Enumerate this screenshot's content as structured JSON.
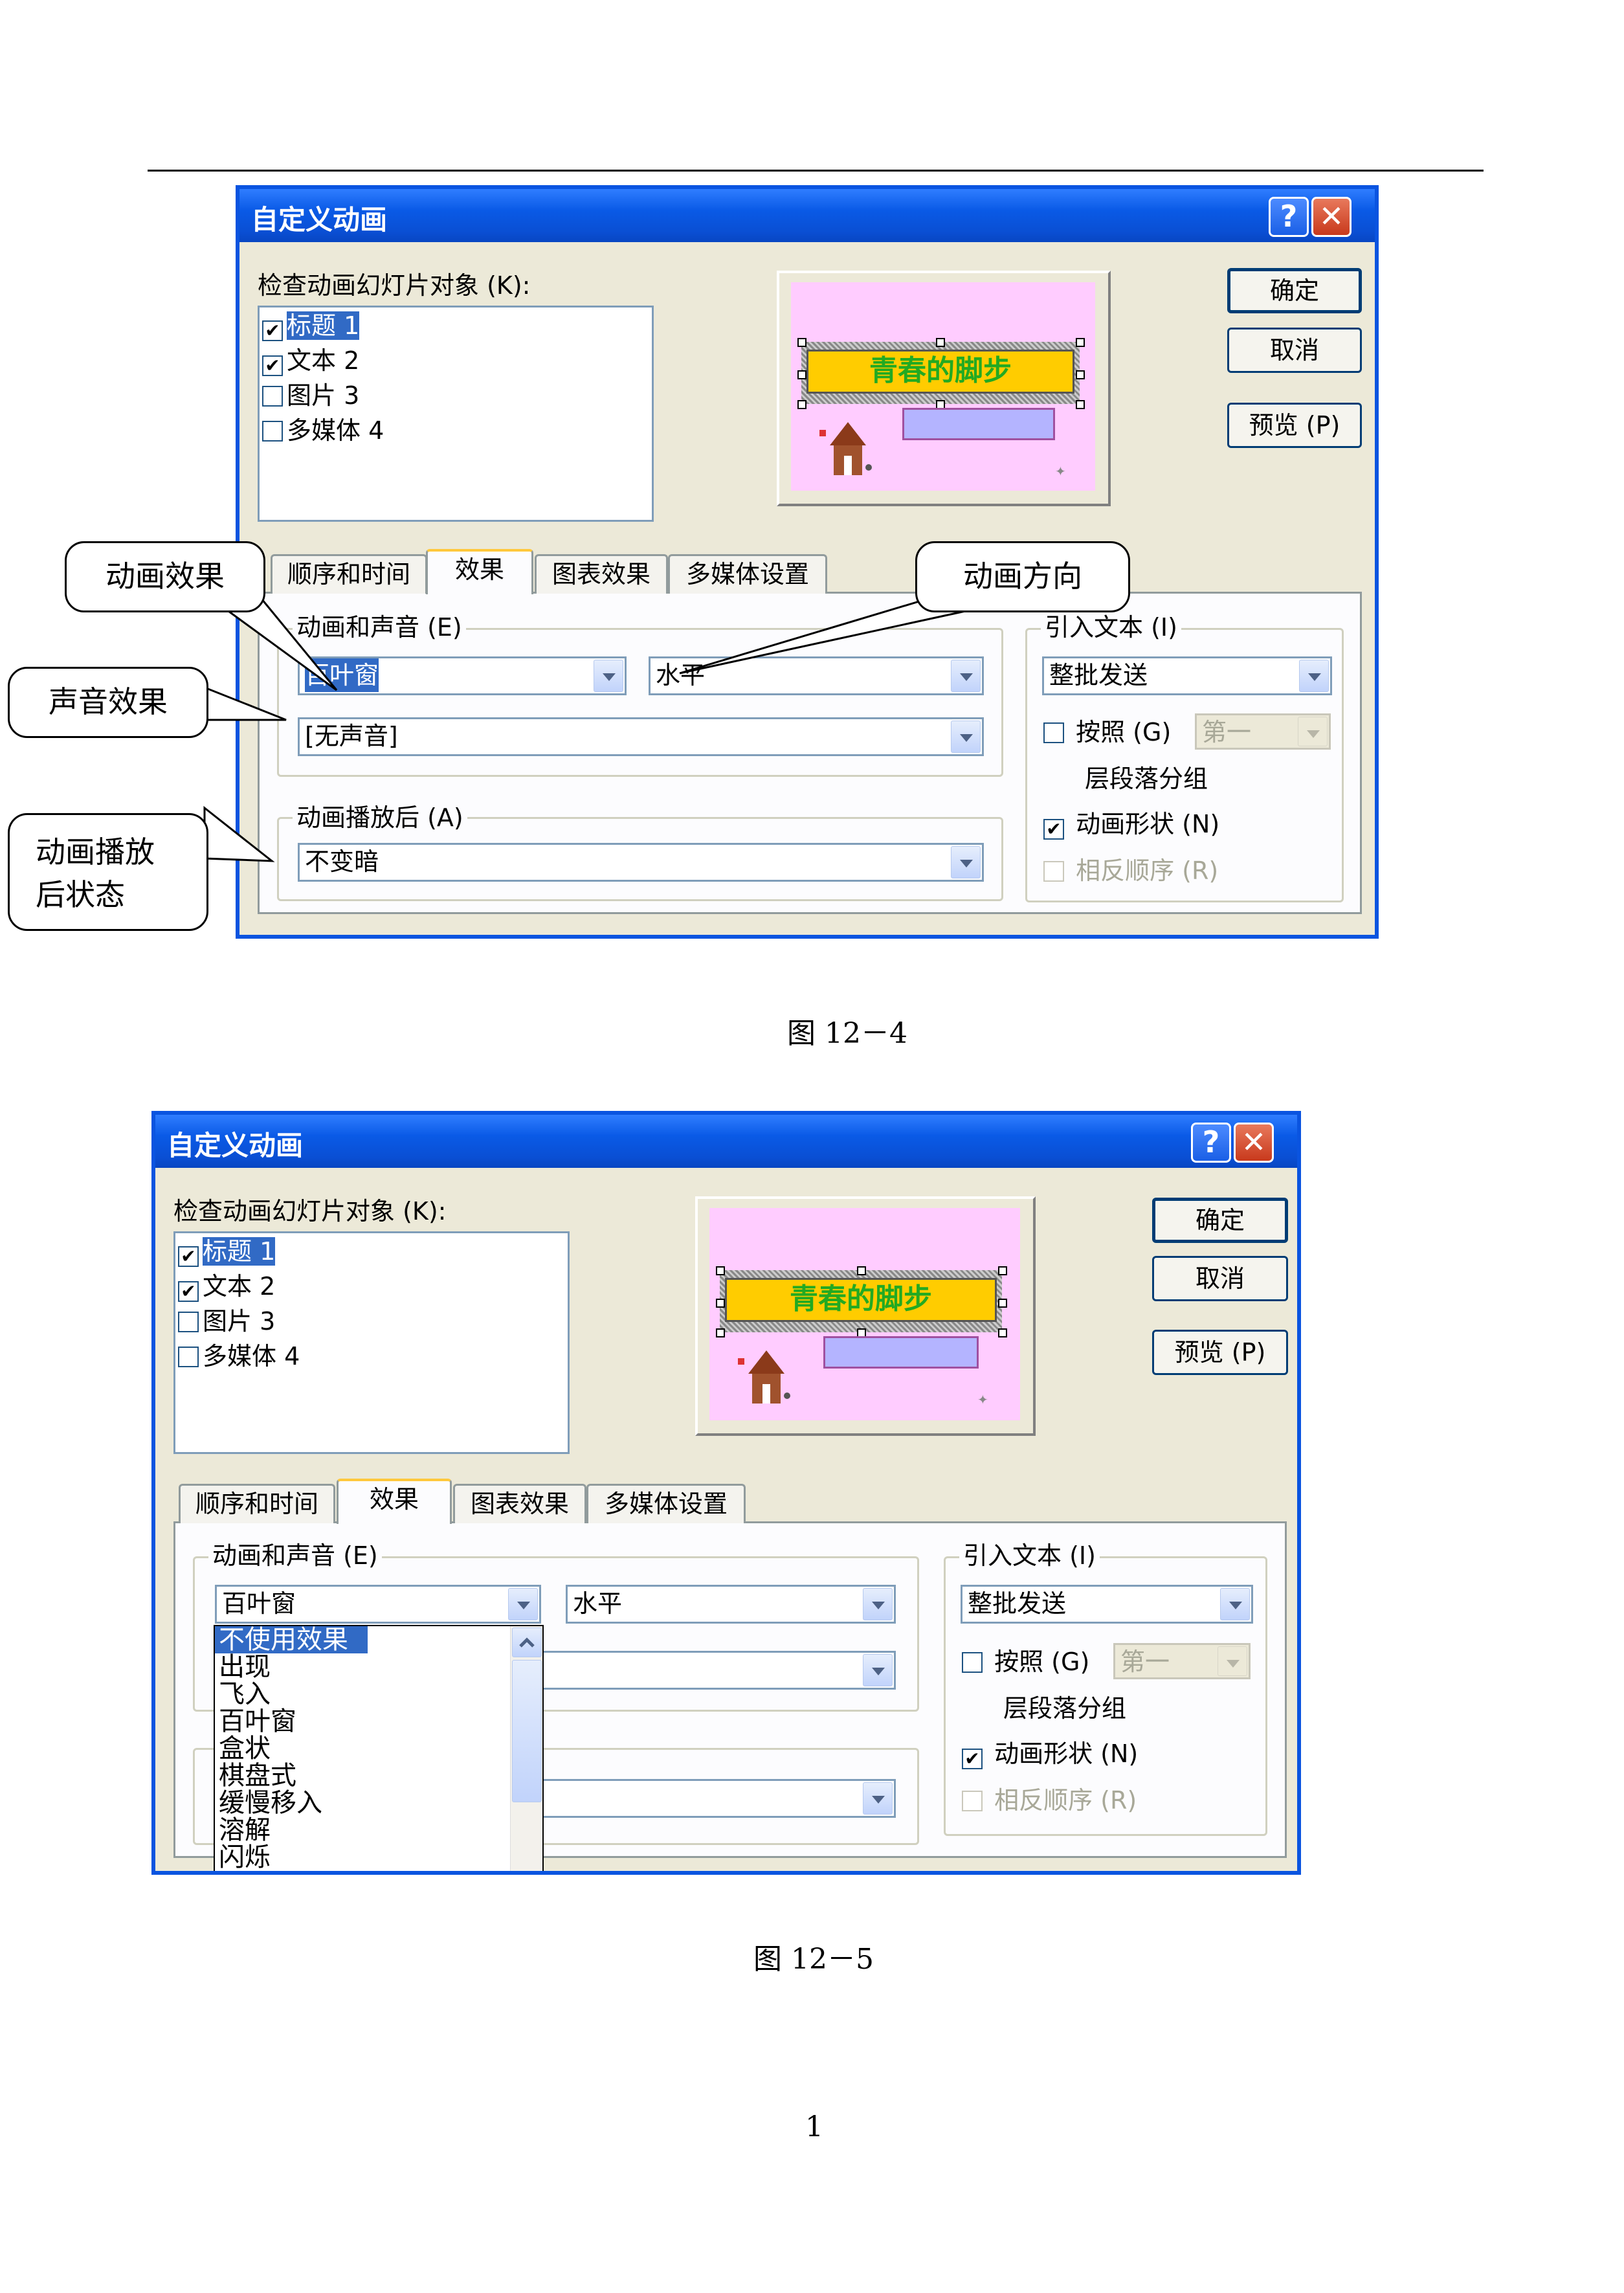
{
  "dialog": {
    "title": "自定义动画",
    "help_glyph": "?",
    "close_glyph": "✕",
    "check_label": "检查动画幻灯片对象 (K):",
    "objects": [
      {
        "label": "标题 1",
        "checked": true,
        "selected": true
      },
      {
        "label": "文本 2",
        "checked": true,
        "selected": false
      },
      {
        "label": "图片 3",
        "checked": false,
        "selected": false
      },
      {
        "label": "多媒体 4",
        "checked": false,
        "selected": false
      }
    ],
    "ok_label": "确定",
    "cancel_label": "取消",
    "preview_label": "预览 (P)",
    "slide_title": "青春的脚步",
    "tabs": [
      "顺序和时间",
      "效果",
      "图表效果",
      "多媒体设置"
    ],
    "group_anim_sound": "动画和声音 (E)",
    "group_after": "动画播放后 (A)",
    "group_intro": "引入文本 (I)",
    "effect_value": "百叶窗",
    "direction_value": "水平",
    "sound_value": "[无声音]",
    "after_value": "不变暗",
    "intro_value": "整批发送",
    "by_label": "按照 (G)",
    "by_value": "第一",
    "para_label": "层段落分组",
    "anim_shape_label": "动画形状 (N)",
    "reverse_label": "相反顺序 (R)"
  },
  "figure1": {
    "callouts": {
      "effect": "动画效果",
      "direction": "动画方向",
      "sound": "声音效果",
      "after": "动画播放后状态"
    },
    "caption": "图 12－4"
  },
  "figure2": {
    "dropdown_items": [
      "不使用效果",
      "出现",
      "飞入",
      "百叶窗",
      "盒状",
      "棋盘式",
      "缓慢移入",
      "溶解",
      "闪烁"
    ],
    "caption": "图 12－5"
  },
  "page_number": "1",
  "colors": {
    "title_bar": "#0a5ae6",
    "dialog_bg": "#ece9d8",
    "selection": "#316ac5",
    "slide_bg": "#ffccff",
    "slide_title_bg": "#ffcc00"
  }
}
